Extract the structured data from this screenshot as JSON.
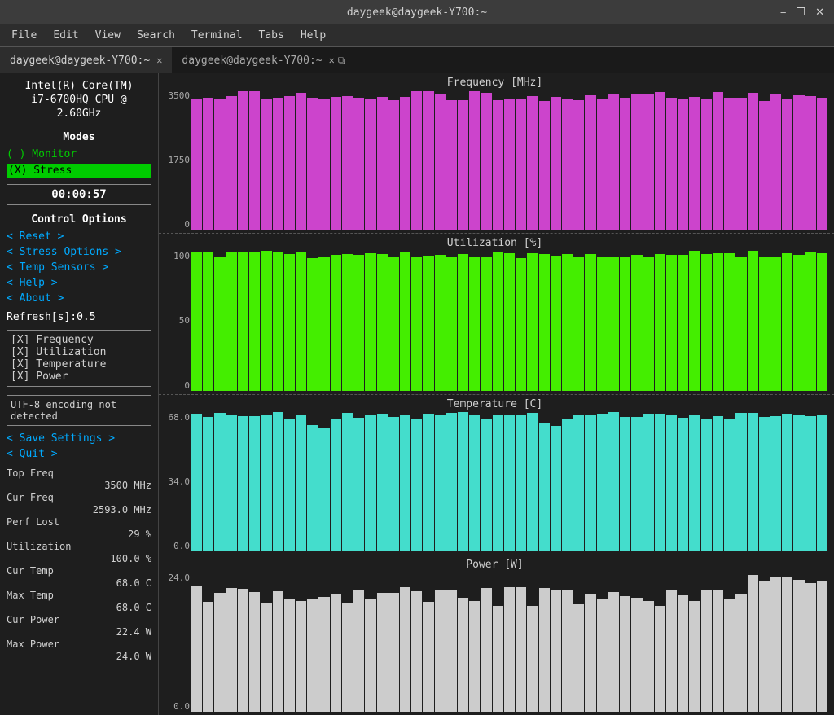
{
  "window": {
    "title": "daygeek@daygeek-Y700:~",
    "tab1_label": "daygeek@daygeek-Y700:~",
    "tab2_label": "daygeek@daygeek-Y700:~"
  },
  "menubar": {
    "items": [
      "File",
      "Edit",
      "View",
      "Search",
      "Terminal",
      "Tabs",
      "Help"
    ]
  },
  "cpu_info": {
    "line1": "Intel(R) Core(TM)",
    "line2": "i7-6700HQ CPU @",
    "line3": "2.60GHz"
  },
  "modes": {
    "label": "Modes",
    "monitor": "( ) Monitor",
    "stress": "(X) Stress"
  },
  "timer": "00:00:57",
  "control_options": {
    "label": "Control Options",
    "items": [
      "< Reset          >",
      "< Stress Options >",
      "< Temp Sensors   >",
      "< Help           >",
      "< About          >"
    ]
  },
  "refresh": "Refresh[s]:0.5",
  "checkboxes": {
    "frequency": "[X] Frequency",
    "utilization": "[X] Utilization",
    "temperature": "[X] Temperature",
    "power": "[X] Power"
  },
  "encoding_msg": "UTF-8 encoding not detected",
  "save_settings": "< Save Settings  >",
  "quit": "< Quit           >",
  "stats": {
    "top_freq_label": "Top Freq",
    "top_freq_value": "3500 MHz",
    "cur_freq_label": "Cur Freq",
    "cur_freq_value": "2593.0 MHz",
    "perf_lost_label": "Perf Lost",
    "perf_lost_value": "29 %",
    "utilization_label": "Utilization",
    "utilization_value": "100.0 %",
    "cur_temp_label": "Cur Temp",
    "cur_temp_value": "68.0 C",
    "max_temp_label": "Max Temp",
    "max_temp_value": "68.0 C",
    "cur_power_label": "Cur Power",
    "cur_power_value": "22.4 W",
    "max_power_label": "Max Power",
    "max_power_value": "24.0 W"
  },
  "charts": {
    "frequency": {
      "title": "Frequency [MHz]",
      "y_labels": [
        "3500",
        "1750",
        "0"
      ],
      "bar_count": 55,
      "bar_height_pct": 100,
      "color": "freq"
    },
    "utilization": {
      "title": "Utilization [%]",
      "y_labels": [
        "100",
        "50",
        "0"
      ],
      "bar_count": 55,
      "bar_height_pct": 100,
      "color": "util"
    },
    "temperature": {
      "title": "Temperature [C]",
      "y_labels": [
        "68.0",
        "34.0",
        "0.0"
      ],
      "bar_count": 55,
      "color": "temp"
    },
    "power": {
      "title": "Power [W]",
      "y_labels": [
        "24.0",
        "",
        "0.0"
      ],
      "bar_count": 55,
      "color": "power"
    }
  }
}
